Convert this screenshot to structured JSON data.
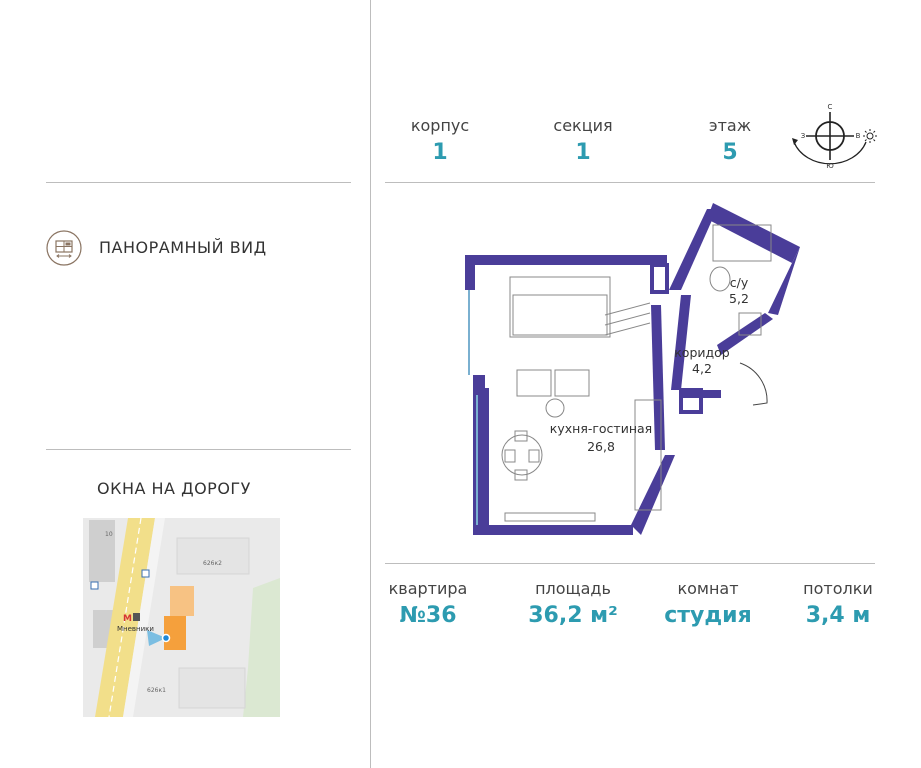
{
  "header": {
    "korpus_label": "корпус",
    "korpus_value": "1",
    "sekciya_label": "секция",
    "sekciya_value": "1",
    "etazh_label": "этаж",
    "etazh_value": "5"
  },
  "compass": {
    "n": "С",
    "s": "Ю",
    "w": "З",
    "e": "В"
  },
  "sidebar": {
    "panoramic_view": "ПАНОРАМНЫЙ ВИД",
    "windows_title": "ОКНА НА ДОРОГУ"
  },
  "map": {
    "metro_label": "Мневники",
    "building_1": "626к2",
    "building_2": "626к1",
    "house_num": "10"
  },
  "plan": {
    "bathroom_label": "с/у",
    "bathroom_area": "5,2",
    "corridor_label": "коридор",
    "corridor_area": "4,2",
    "living_label": "кухня-гостиная",
    "living_area": "26,8"
  },
  "footer": {
    "apartment_label": "квартира",
    "apartment_value": "№36",
    "area_label": "площадь",
    "area_value": "36,2 м²",
    "rooms_label": "комнат",
    "rooms_value": "студия",
    "ceiling_label": "потолки",
    "ceiling_value": "3,4 м"
  },
  "colors": {
    "accent": "#2d9bb0",
    "wall": "#4a3d99",
    "map_highlight": "#f5a03c",
    "map_road": "#f2df8a"
  }
}
